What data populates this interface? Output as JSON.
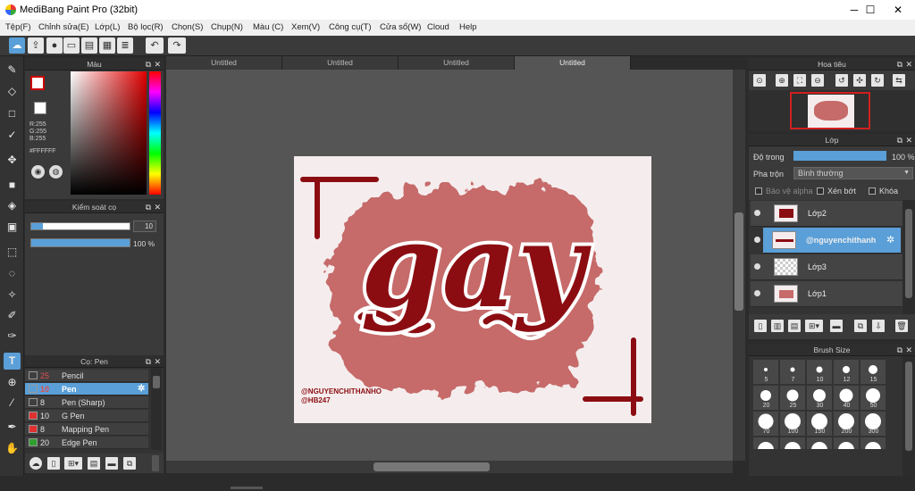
{
  "window": {
    "title": "MediBang Paint Pro (32bit)",
    "minimize": "─",
    "maximize": "☐",
    "close": "✕"
  },
  "menu": [
    "Tệp(F)",
    "Chỉnh sửa(E)",
    "Lớp(L)",
    "Bộ lọc(R)",
    "Chọn(S)",
    "Chụp(N)",
    "Màu (C)",
    "Xem(V)",
    "Công cụ(T)",
    "Cửa sổ(W)",
    "Cloud",
    "Help"
  ],
  "tabs": [
    "Untitled",
    "Untitled",
    "Untitled",
    "Untitled"
  ],
  "color_panel": {
    "title": "Màu",
    "r": "R:255",
    "g": "G:255",
    "b": "B:255",
    "hex": "#FFFFFF",
    "primary_color": "#ffffff",
    "secondary_color": "#ffffff"
  },
  "control_panel": {
    "title": "Kiểm soát cọ",
    "size_value": "10",
    "opacity_value": "100 %",
    "size_fraction": 0.12,
    "opacity_fraction": 1.0
  },
  "brush_panel": {
    "title": "Cọ: Pen",
    "brushes": [
      {
        "size": "25",
        "name": "Pencil",
        "color": "#333333"
      },
      {
        "size": "10",
        "name": "Pen",
        "color": "#333333"
      },
      {
        "size": "8",
        "name": "Pen (Sharp)",
        "color": "#333333"
      },
      {
        "size": "10",
        "name": "G Pen",
        "color": "#e03030"
      },
      {
        "size": "8",
        "name": "Mapping Pen",
        "color": "#e03030"
      },
      {
        "size": "20",
        "name": "Edge Pen",
        "color": "#30a030"
      }
    ]
  },
  "canvas": {
    "word": "gay",
    "credit_line1": "@NGUYENCHITHANHO",
    "credit_line2": "@HB247"
  },
  "navigator": {
    "title": "Hoa tiêu"
  },
  "layer_panel": {
    "title": "Lớp",
    "opacity_label": "Độ trong",
    "opacity_value": "100 %",
    "blend_label": "Pha trộn",
    "blend_value": "Bình thường",
    "protect_alpha": "Bảo vệ alpha",
    "clipping": "Xén bớt",
    "lock": "Khóa",
    "layers": [
      "Lớp2",
      "@nguyenchithanh",
      "Lớp3",
      "Lớp1"
    ]
  },
  "brush_size_panel": {
    "title": "Brush Size",
    "sizes": [
      "5",
      "7",
      "10",
      "12",
      "15",
      "20",
      "25",
      "30",
      "40",
      "50",
      "70",
      "100",
      "150",
      "200",
      "300"
    ]
  },
  "colors": {
    "accent": "#5a9fd8",
    "ink": "#8b0d12"
  }
}
